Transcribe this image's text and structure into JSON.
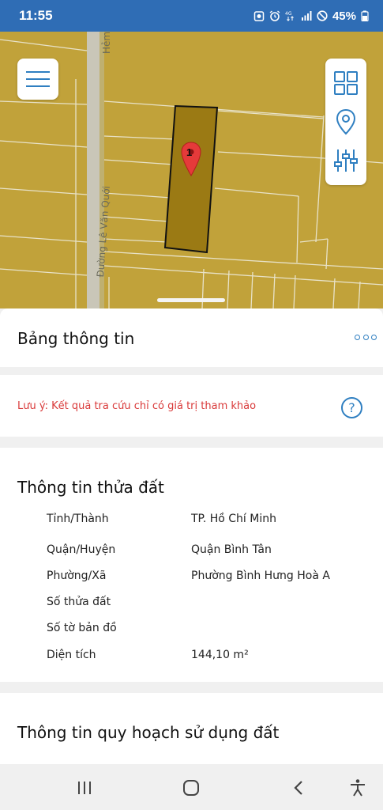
{
  "status_bar": {
    "time": "11:55",
    "battery": "45%",
    "icons": [
      "camera-icon",
      "alarm-icon",
      "data-icon",
      "signal-icon",
      "dnd-icon",
      "battery-icon"
    ]
  },
  "map": {
    "street_label_1": "Hẻm",
    "street_label_2": "Đường Lê Văn Quới",
    "parcel_marker": "1",
    "colors": {
      "land": "#c1a23a",
      "parcel": "#9b7a14",
      "road": "#c9c6b8"
    }
  },
  "map_controls": {
    "menu": "menu-icon",
    "tools": [
      "grid-icon",
      "location-pin-icon",
      "filter-sliders-icon"
    ]
  },
  "sheet": {
    "title": "Bảng thông tin",
    "note": "Lưu ý: Kết quả tra cứu chỉ có giá trị tham khảo",
    "help": "?"
  },
  "parcel_info": {
    "title": "Thông tin thửa đất",
    "rows": [
      {
        "label": "Tỉnh/Thành",
        "value": "TP. Hồ Chí Minh"
      },
      {
        "label": "Quận/Huyện",
        "value": "Quận Bình Tân"
      },
      {
        "label": "Phường/Xã",
        "value": "Phường Bình Hưng Hoà A"
      },
      {
        "label": "Số thửa đất",
        "value": ""
      },
      {
        "label": "Số tờ bản đồ",
        "value": ""
      },
      {
        "label": "Diện tích",
        "value": "144,10 m²"
      }
    ]
  },
  "land_use": {
    "title": "Thông tin quy hoạch sử dụng đất"
  },
  "nav_bar": {
    "items": [
      "recents-icon",
      "home-icon",
      "back-icon",
      "accessibility-icon"
    ]
  },
  "accent_color": "#2f7fc1",
  "status_bar_color": "#2f6db5",
  "note_color": "#d93a3a"
}
